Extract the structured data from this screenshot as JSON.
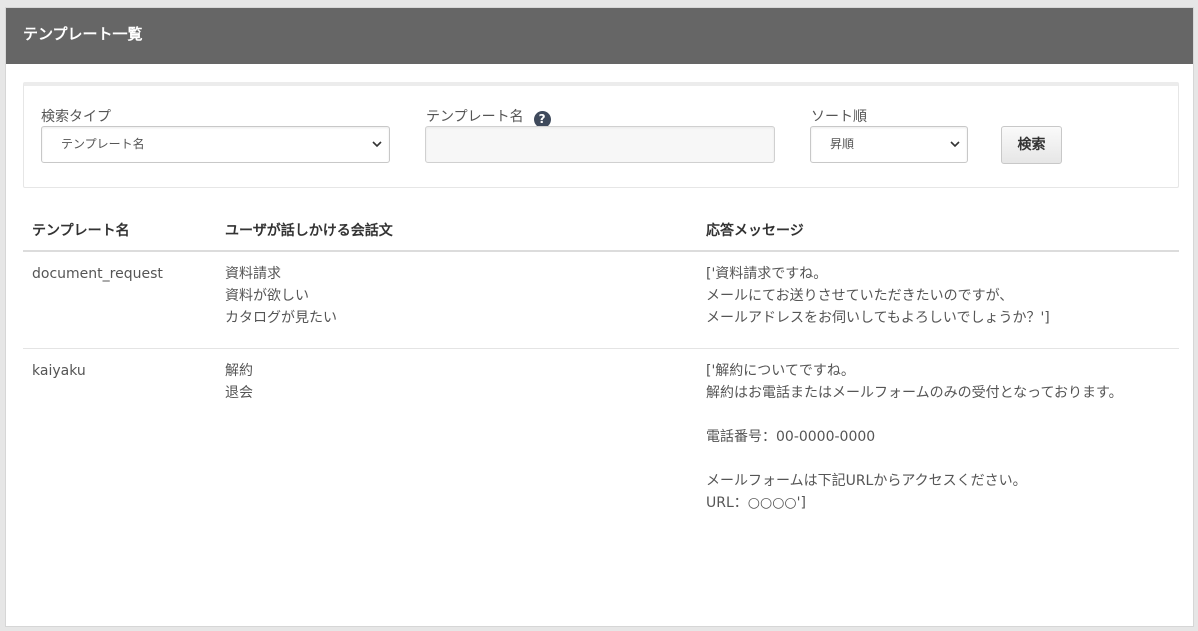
{
  "header": {
    "title": "テンプレート一覧"
  },
  "search": {
    "type_label": "検索タイプ",
    "type_value": "テンプレート名",
    "name_label": "テンプレート名",
    "name_help": "?",
    "name_value": "",
    "sort_label": "ソート順",
    "sort_value": "昇順",
    "button_label": "検索"
  },
  "table": {
    "headers": [
      "テンプレート名",
      "ユーザが話しかける会話文",
      "応答メッセージ"
    ],
    "rows": [
      {
        "name": "document_request",
        "phrases": [
          "資料請求",
          "資料が欲しい",
          "カタログが見たい"
        ],
        "response": [
          "['資料請求ですね。",
          "メールにてお送りさせていただきたいのですが、",
          "メールアドレスをお伺いしてもよろしいでしょうか？']"
        ]
      },
      {
        "name": "kaiyaku",
        "phrases": [
          "解約",
          "退会"
        ],
        "response": [
          "['解約についてですね。",
          "解約はお電話またはメールフォームのみの受付となっております。",
          "",
          "電話番号：00-0000-0000",
          "",
          "メールフォームは下記URLからアクセスください。",
          "URL：○○○○']"
        ]
      }
    ]
  }
}
